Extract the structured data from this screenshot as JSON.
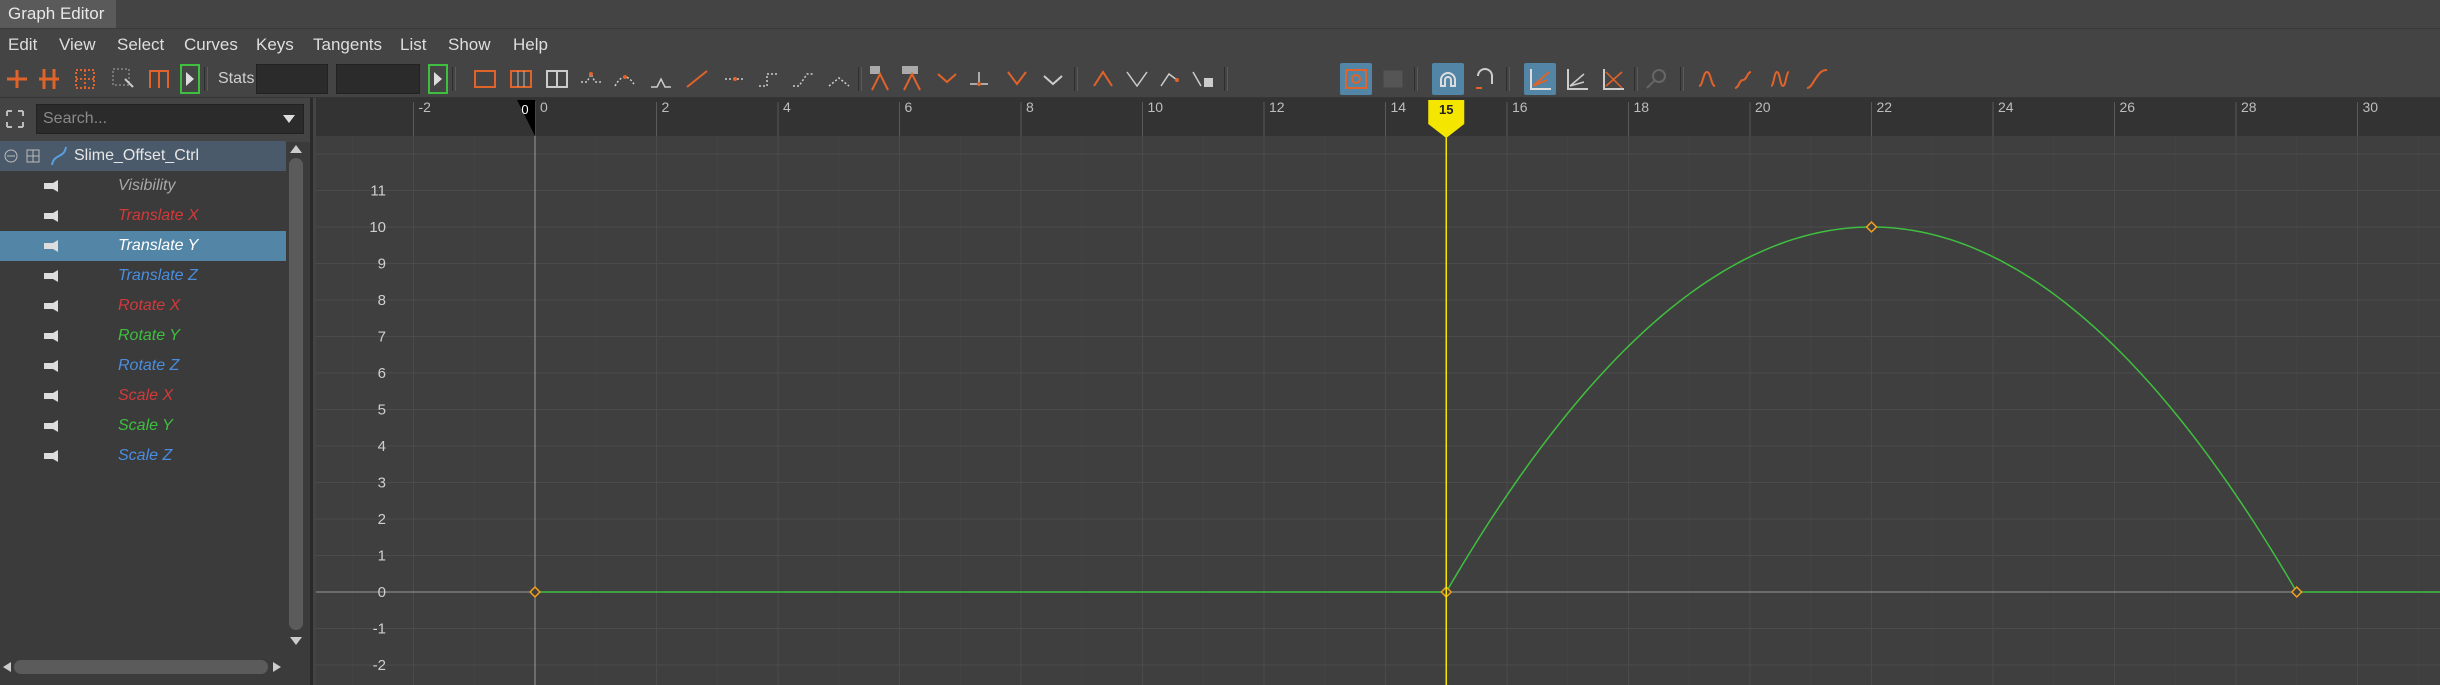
{
  "window": {
    "title": "Graph Editor"
  },
  "menu": [
    "Edit",
    "View",
    "Select",
    "Curves",
    "Keys",
    "Tangents",
    "List",
    "Show",
    "Help"
  ],
  "toolbar": {
    "stats_label": "Stats",
    "stats_value": "",
    "stats_value2": ""
  },
  "search": {
    "placeholder": "Search..."
  },
  "outliner": {
    "root": "Slime_Offset_Ctrl",
    "channels": [
      {
        "label": "Visibility",
        "color": "#a8a8a8",
        "selected": false
      },
      {
        "label": "Translate X",
        "color": "#d23a3a",
        "selected": false
      },
      {
        "label": "Translate Y",
        "color": "#ffffff",
        "selected": true
      },
      {
        "label": "Translate Z",
        "color": "#4a8ee0",
        "selected": false
      },
      {
        "label": "Rotate X",
        "color": "#d23a3a",
        "selected": false
      },
      {
        "label": "Rotate Y",
        "color": "#3fbf3f",
        "selected": false
      },
      {
        "label": "Rotate Z",
        "color": "#4a8ee0",
        "selected": false
      },
      {
        "label": "Scale X",
        "color": "#d23a3a",
        "selected": false
      },
      {
        "label": "Scale Y",
        "color": "#3fbf3f",
        "selected": false
      },
      {
        "label": "Scale Z",
        "color": "#4a8ee0",
        "selected": false
      }
    ]
  },
  "graph": {
    "x_ticks": [
      "-2",
      "0",
      "2",
      "4",
      "6",
      "8",
      "10",
      "12",
      "14",
      "16",
      "18",
      "20",
      "22",
      "24",
      "26",
      "28",
      "30"
    ],
    "y_ticks": [
      "11",
      "10",
      "9",
      "8",
      "7",
      "6",
      "5",
      "4",
      "3",
      "2",
      "1",
      "0",
      "-1",
      "-2"
    ],
    "current_frame": "15",
    "range_start_marker": "0",
    "curve_color": "#3fbf3f",
    "timeline_color": "#f5e600",
    "keys": [
      {
        "frame": 0,
        "value": 0
      },
      {
        "frame": 15,
        "value": 0
      },
      {
        "frame": 22,
        "value": 10
      },
      {
        "frame": 29,
        "value": 0
      }
    ]
  },
  "colors": {
    "accent": "#5285a6",
    "key": "#f0a020"
  }
}
